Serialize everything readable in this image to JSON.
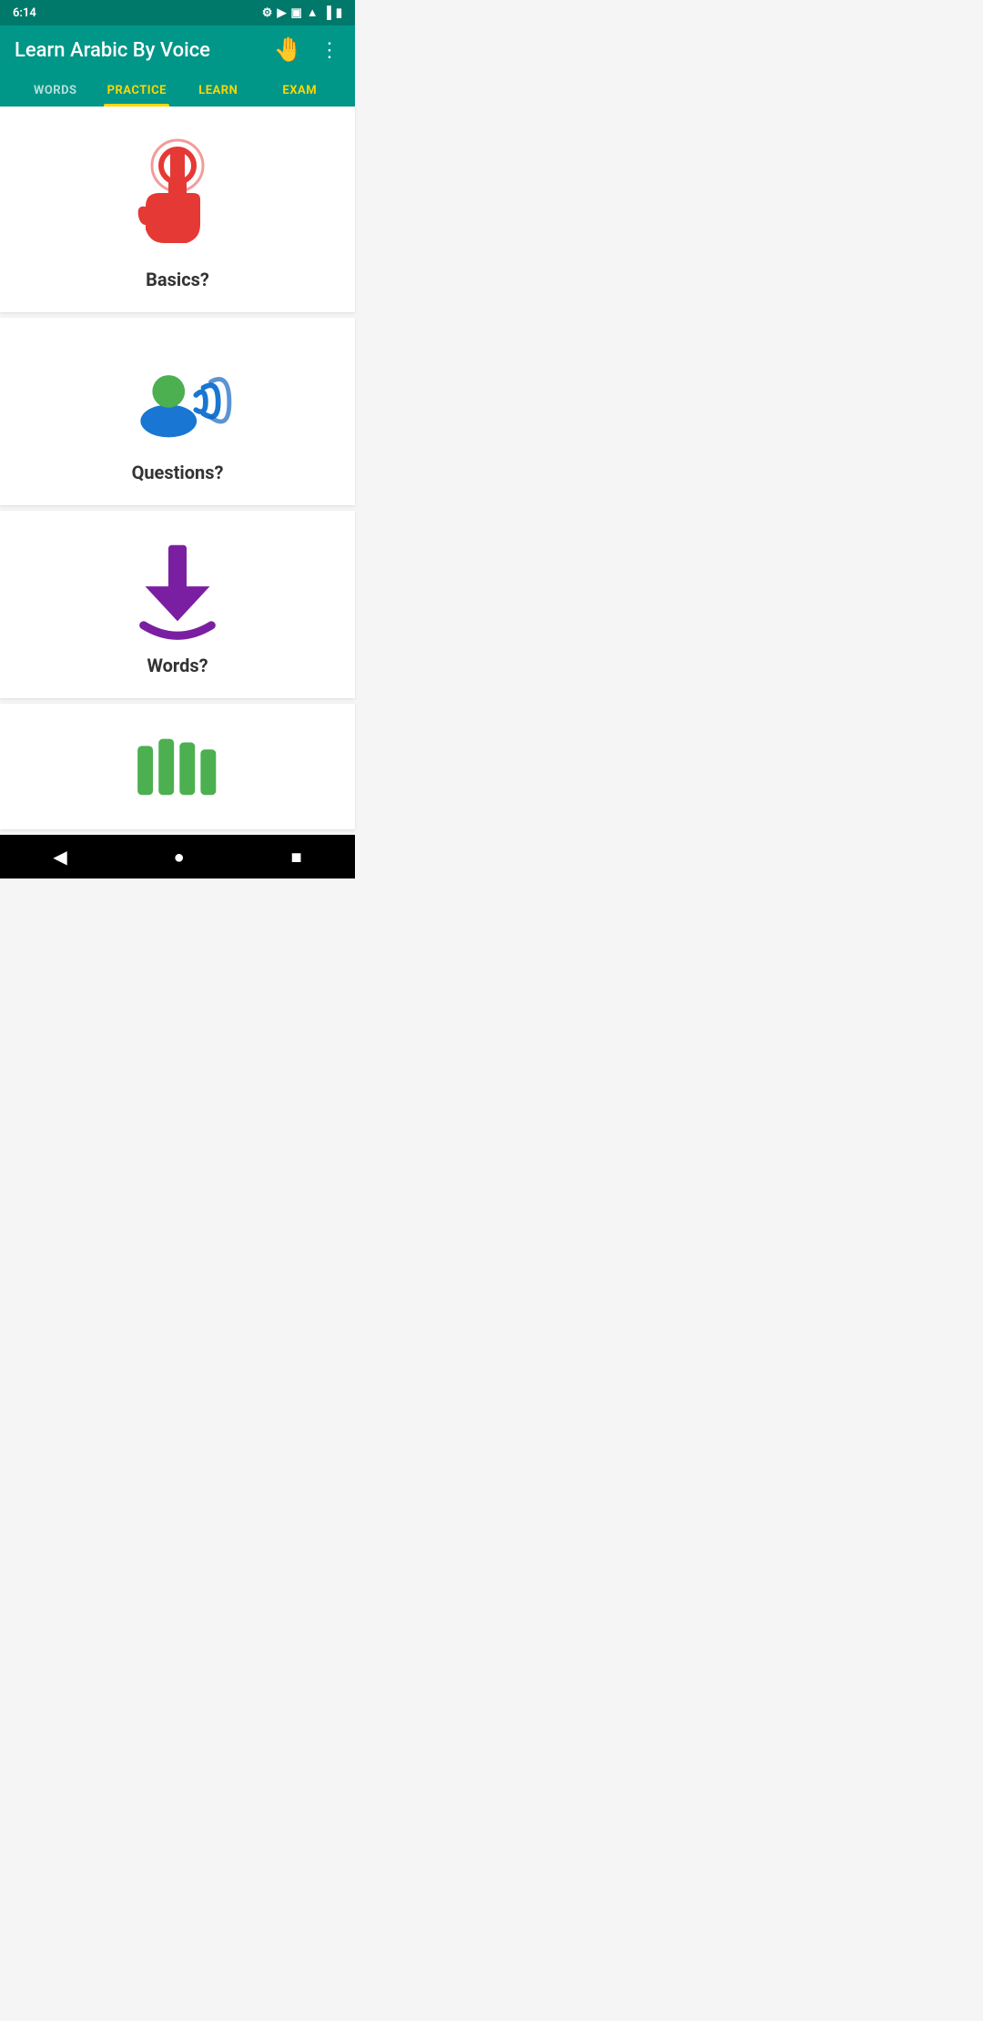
{
  "statusBar": {
    "time": "6:14",
    "bgColor": "#00796B"
  },
  "toolbar": {
    "title": "Learn Arabic By Voice",
    "bgColor": "#009688",
    "handIcon": "🤚",
    "moreIcon": "⋮"
  },
  "tabs": [
    {
      "id": "words",
      "label": "WORDS",
      "active": false
    },
    {
      "id": "practice",
      "label": "PRACTICE",
      "active": true
    },
    {
      "id": "learn",
      "label": "LEARN",
      "active": false
    },
    {
      "id": "exam",
      "label": "EXAM",
      "active": false
    }
  ],
  "cards": [
    {
      "id": "basics",
      "label": "Basics?",
      "iconType": "touch"
    },
    {
      "id": "questions",
      "label": "Questions?",
      "iconType": "voice"
    },
    {
      "id": "words",
      "label": "Words?",
      "iconType": "download"
    },
    {
      "id": "progress",
      "label": "",
      "iconType": "bars"
    }
  ],
  "colors": {
    "teal": "#009688",
    "yellow": "#FFD600",
    "red": "#E53935",
    "blue": "#1976D2",
    "green": "#4CAF50",
    "purple": "#7B1FA2"
  }
}
